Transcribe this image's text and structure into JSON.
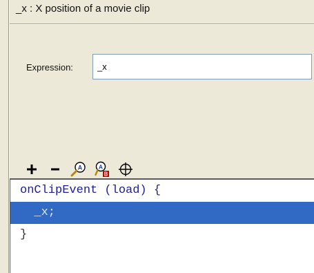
{
  "header": {
    "description": "_x : X position of a movie clip"
  },
  "expression": {
    "label": "Expression:",
    "value": "_x"
  },
  "toolbar": {
    "buttons": [
      {
        "name": "add",
        "icon": "plus-icon",
        "glyph": "+"
      },
      {
        "name": "remove",
        "icon": "minus-icon",
        "glyph": "−"
      },
      {
        "name": "find",
        "icon": "find-magnifier-icon"
      },
      {
        "name": "replace",
        "icon": "replace-icon"
      },
      {
        "name": "insert-target-path",
        "icon": "target-crosshair-icon"
      }
    ]
  },
  "code": {
    "lines": [
      "onClipEvent (load) {",
      "  _x;",
      "}"
    ],
    "selected_line_index": 1
  },
  "colors": {
    "background": "#ece9d8",
    "selection": "#316ac5",
    "keyword": "#1d1d99"
  }
}
